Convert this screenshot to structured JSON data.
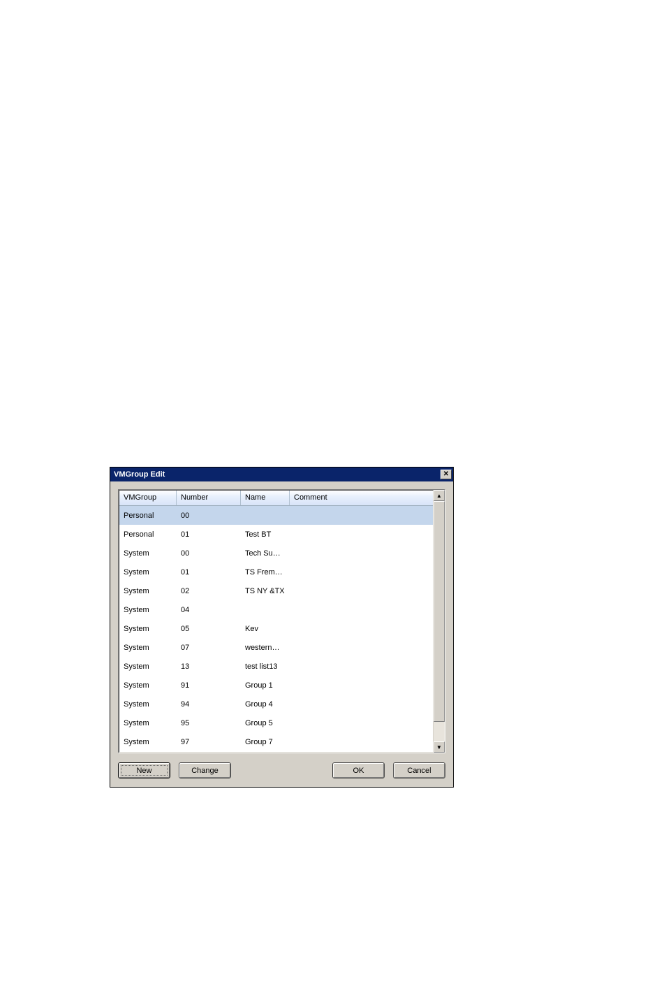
{
  "window": {
    "title": "VMGroup Edit"
  },
  "columns": {
    "vmgroup": "VMGroup",
    "number": "Number",
    "name": "Name",
    "comment": "Comment"
  },
  "rows": [
    {
      "vmgroup": "Personal",
      "number": "00",
      "name": "",
      "comment": "",
      "selected": true
    },
    {
      "vmgroup": "Personal",
      "number": "01",
      "name": "Test BT",
      "comment": "",
      "selected": false
    },
    {
      "vmgroup": "System",
      "number": "00",
      "name": "Tech Su…",
      "comment": "",
      "selected": false
    },
    {
      "vmgroup": "System",
      "number": "01",
      "name": "TS Frem…",
      "comment": "",
      "selected": false
    },
    {
      "vmgroup": "System",
      "number": "02",
      "name": "TS NY &TX",
      "comment": "",
      "selected": false
    },
    {
      "vmgroup": "System",
      "number": "04",
      "name": "",
      "comment": "",
      "selected": false
    },
    {
      "vmgroup": "System",
      "number": "05",
      "name": "Kev",
      "comment": "",
      "selected": false
    },
    {
      "vmgroup": "System",
      "number": "07",
      "name": "western…",
      "comment": "",
      "selected": false
    },
    {
      "vmgroup": "System",
      "number": "13",
      "name": "test list13",
      "comment": "",
      "selected": false
    },
    {
      "vmgroup": "System",
      "number": "91",
      "name": "Group 1",
      "comment": "",
      "selected": false
    },
    {
      "vmgroup": "System",
      "number": "94",
      "name": "Group 4",
      "comment": "",
      "selected": false
    },
    {
      "vmgroup": "System",
      "number": "95",
      "name": "Group 5",
      "comment": "",
      "selected": false
    },
    {
      "vmgroup": "System",
      "number": "97",
      "name": "Group 7",
      "comment": "",
      "selected": false
    }
  ],
  "buttons": {
    "new": "New",
    "change": "Change",
    "ok": "OK",
    "cancel": "Cancel"
  }
}
